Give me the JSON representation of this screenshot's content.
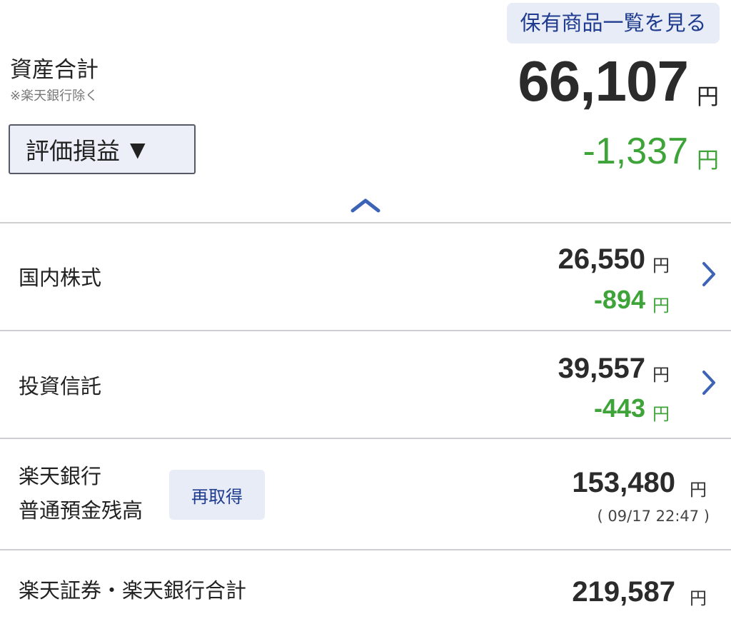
{
  "summary": {
    "holdings_button": "保有商品一覧を見る",
    "asset_label": "資産合計",
    "asset_note": "※楽天銀行除く",
    "total_amount": "66,107",
    "total_unit": "円",
    "eval_select": "評価損益",
    "total_change": "-1,337",
    "change_unit": "円"
  },
  "rows": {
    "domestic": {
      "label": "国内株式",
      "amount": "26,550",
      "change": "-894",
      "unit": "円"
    },
    "fund": {
      "label": "投資信託",
      "amount": "39,557",
      "change": "-443",
      "unit": "円"
    },
    "bank": {
      "label_line1": "楽天銀行",
      "label_line2": "普通預金残高",
      "refetch_button": "再取得",
      "amount": "153,480",
      "unit": "円",
      "timestamp": "( 09/17 22:47 )"
    },
    "combined": {
      "label": "楽天証券・楽天銀行合計",
      "amount": "219,587",
      "unit": "円"
    }
  },
  "colors": {
    "positive_text": "#2b2b2b",
    "negative_green": "#3ea43a",
    "accent_blue": "#1f3b8f",
    "button_bg": "#e8ecf7"
  }
}
